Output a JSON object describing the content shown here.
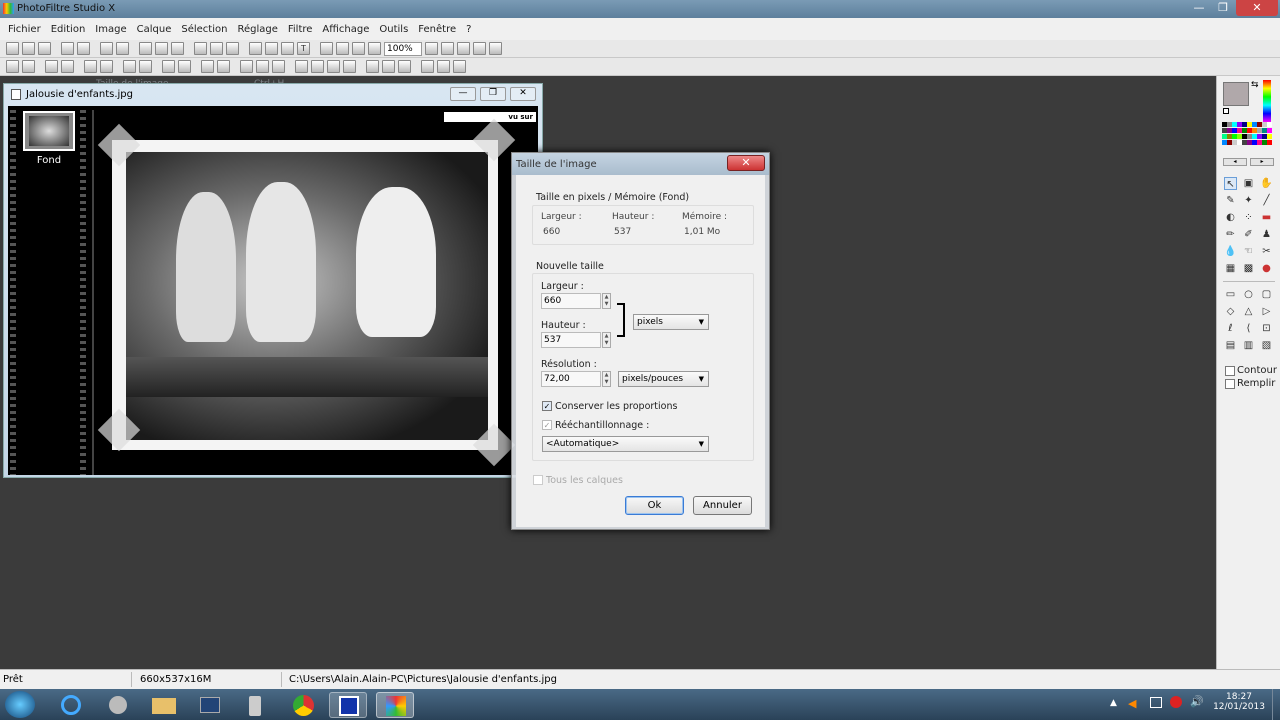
{
  "app": {
    "title": "PhotoFiltre Studio X"
  },
  "menu": [
    "Fichier",
    "Edition",
    "Image",
    "Calque",
    "Sélection",
    "Réglage",
    "Filtre",
    "Affichage",
    "Outils",
    "Fenêtre",
    "?"
  ],
  "toolbar": {
    "zoom": "100%"
  },
  "ghost_menu": {
    "label": "Taille de l'image...",
    "shortcut": "Ctrl+H"
  },
  "document": {
    "title": "Jalousie d'enfants.jpg",
    "layer_label": "Fond",
    "watermark": "vu sur YATAHONGA.com"
  },
  "dialog": {
    "title": "Taille de l'image",
    "close": "✕",
    "current_section": "Taille en pixels / Mémoire (Fond)",
    "current": {
      "width_label": "Largeur :",
      "width": "660",
      "height_label": "Hauteur :",
      "height": "537",
      "memory_label": "Mémoire :",
      "memory": "1,01 Mo"
    },
    "new_section": "Nouvelle taille",
    "new": {
      "width_label": "Largeur :",
      "width": "660",
      "height_label": "Hauteur :",
      "height": "537",
      "unit": "pixels",
      "resolution_label": "Résolution :",
      "resolution": "72,00",
      "resolution_unit": "pixels/pouces"
    },
    "keep_proportions": "Conserver les proportions",
    "resample": "Rééchantillonnage :",
    "resample_mode": "<Automatique>",
    "all_layers": "Tous les calques",
    "ok": "Ok",
    "cancel": "Annuler"
  },
  "palette": {
    "contour": "Contour",
    "fill": "Remplir"
  },
  "status": {
    "state": "Prêt",
    "size": "660x537x16M",
    "path": "C:\\Users\\Alain.Alain-PC\\Pictures\\Jalousie d'enfants.jpg"
  },
  "taskbar": {
    "time": "18:27",
    "date": "12/01/2013"
  }
}
